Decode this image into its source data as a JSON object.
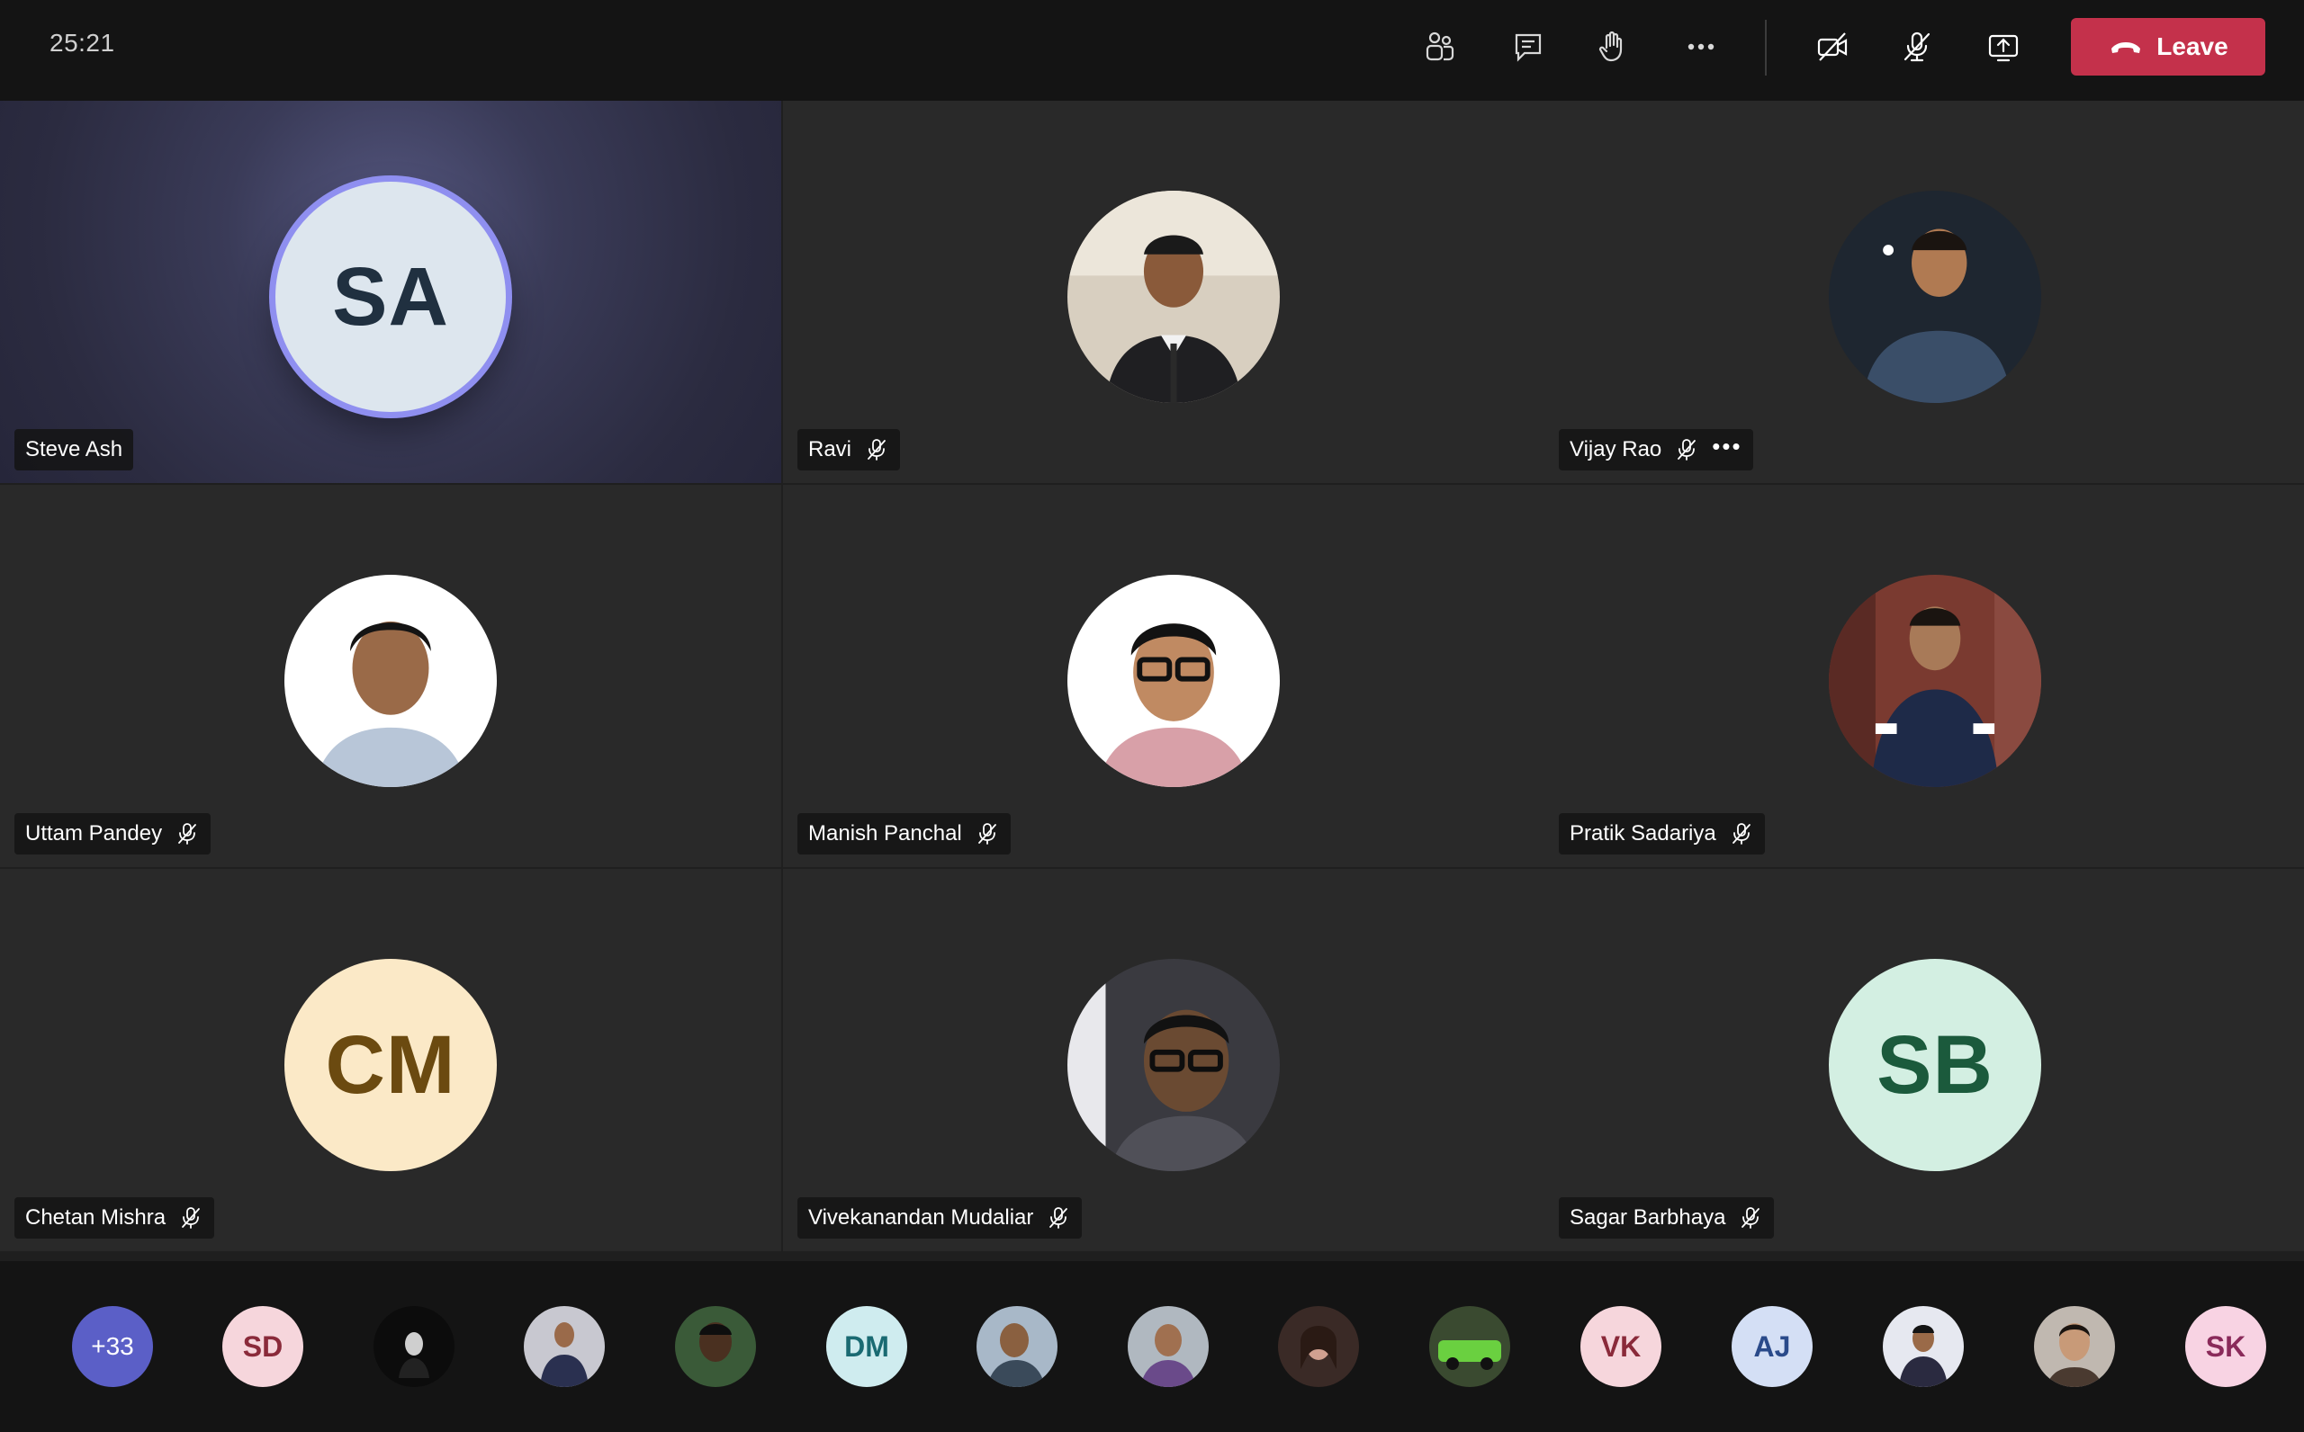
{
  "meeting": {
    "timer": "25:21",
    "leave_label": "Leave",
    "toolbar_icons": [
      "participants-icon",
      "chat-icon",
      "raise-hand-icon",
      "more-icon",
      "camera-off-icon",
      "mic-off-icon",
      "share-screen-icon",
      "phone-hangup-icon"
    ]
  },
  "tiles": [
    {
      "name": "Steve Ash",
      "initials": "SA",
      "type": "initials",
      "muted": false,
      "speaking": true,
      "bg": "#dde6ee",
      "fg": "#203040"
    },
    {
      "name": "Ravi",
      "type": "photo",
      "muted": true,
      "photo_bg": "#d8cfc0",
      "shirt": "#1f1f22"
    },
    {
      "name": "Vijay Rao",
      "type": "photo",
      "muted": true,
      "more": "•••",
      "photo_bg": "#1e2630",
      "shirt": "#3a4e68"
    },
    {
      "name": "Uttam Pandey",
      "type": "photo",
      "muted": true,
      "photo_bg": "#ffffff",
      "shirt": "#b8c6d8"
    },
    {
      "name": "Manish Panchal",
      "type": "photo",
      "muted": true,
      "photo_bg": "#ffffff",
      "shirt": "#d8a0a8"
    },
    {
      "name": "Pratik Sadariya",
      "type": "photo",
      "muted": true,
      "photo_bg": "#7a3a30",
      "shirt": "#1e2a48"
    },
    {
      "name": "Chetan Mishra",
      "initials": "CM",
      "type": "initials",
      "muted": true,
      "bg": "#fbe9c7",
      "fg": "#6b4a10"
    },
    {
      "name": "Vivekanandan Mudaliar",
      "type": "photo",
      "muted": true,
      "photo_bg": "#3a3a40",
      "shirt": "#505058"
    },
    {
      "name": "Sagar Barbhaya",
      "initials": "SB",
      "type": "initials",
      "muted": true,
      "bg": "#d3efe2",
      "fg": "#1b5a3c"
    }
  ],
  "attendees": [
    {
      "label": "+33",
      "type": "overflow",
      "bg": "#5b5fc7",
      "fg": "#ffffff"
    },
    {
      "label": "SD",
      "type": "initials",
      "bg": "#f6d6dc",
      "fg": "#8a2a3a"
    },
    {
      "label": "",
      "type": "photo",
      "bg": "#0c0c0c",
      "accent": "#cfcfcf"
    },
    {
      "label": "",
      "type": "photo",
      "bg": "#c8c8d0",
      "accent": "#2a3050"
    },
    {
      "label": "",
      "type": "photo",
      "bg": "#3a5a38",
      "accent": "#4a3020"
    },
    {
      "label": "DM",
      "type": "initials",
      "bg": "#cfecef",
      "fg": "#1a6a72"
    },
    {
      "label": "",
      "type": "photo",
      "bg": "#a8b8c8",
      "accent": "#3a4a5a"
    },
    {
      "label": "",
      "type": "photo",
      "bg": "#b0b8c0",
      "accent": "#6a4a8a"
    },
    {
      "label": "",
      "type": "photo",
      "bg": "#3a2a26",
      "accent": "#d0a090"
    },
    {
      "label": "",
      "type": "photo",
      "bg": "#3a4a30",
      "accent": "#6ad040"
    },
    {
      "label": "VK",
      "type": "initials",
      "bg": "#f6d6dc",
      "fg": "#8a2a3a"
    },
    {
      "label": "AJ",
      "type": "initials",
      "bg": "#d4dff5",
      "fg": "#2a4a8a"
    },
    {
      "label": "",
      "type": "photo",
      "bg": "#e6e8f0",
      "accent": "#2a2a40"
    },
    {
      "label": "",
      "type": "photo",
      "bg": "#c0b8b0",
      "accent": "#4a3a30"
    },
    {
      "label": "SK",
      "type": "initials",
      "bg": "#f8d3e3",
      "fg": "#8a2a5a"
    }
  ]
}
